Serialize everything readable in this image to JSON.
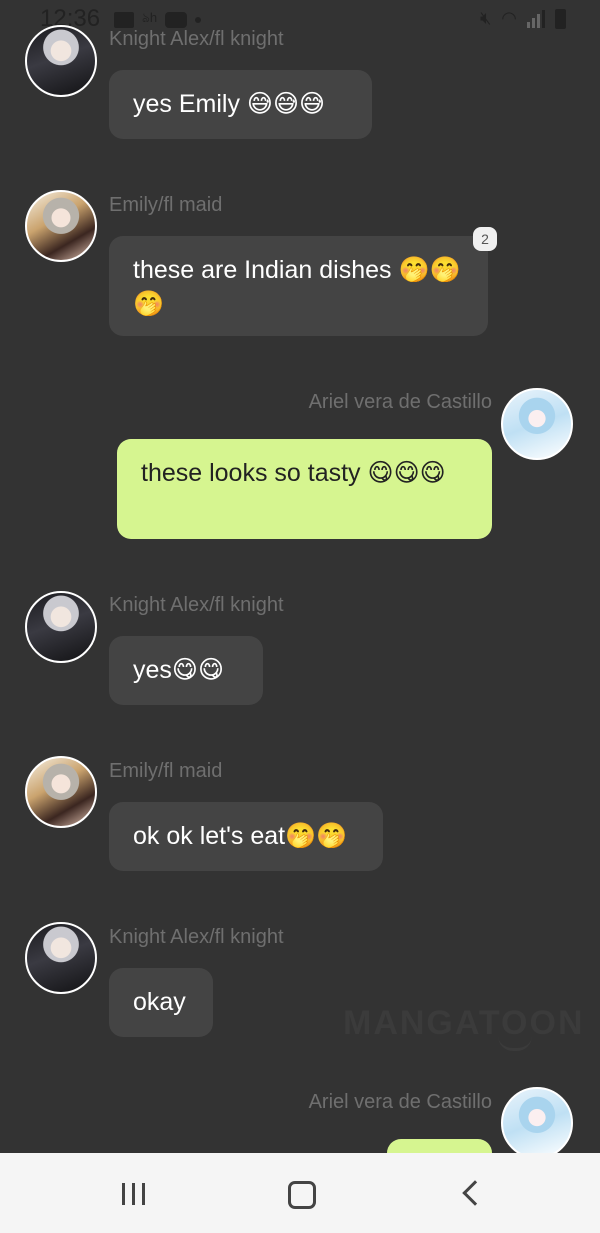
{
  "status_bar": {
    "time": "12:36",
    "left_icons": [
      "image-icon",
      "notification-icon",
      "youtube-icon",
      "dot-icon"
    ],
    "right_icons": [
      "mute-icon",
      "wifi-icon",
      "signal-icon",
      "battery-icon"
    ]
  },
  "messages": [
    {
      "sender": "Knight Alex/fl knight",
      "avatar": "knight-avatar",
      "text": "yes Emily 😅😅😅",
      "mine": false
    },
    {
      "sender": "Emily/fl maid",
      "avatar": "maid-avatar",
      "text": "these are Indian dishes 🤭🤭🤭",
      "mine": false,
      "reply_count": "2"
    },
    {
      "sender": "Ariel vera de Castillo",
      "avatar": "ariel-avatar",
      "text": "these looks so tasty 😋😋😋",
      "mine": true
    },
    {
      "sender": "Knight Alex/fl knight",
      "avatar": "knight-avatar",
      "text": "yes😋😋",
      "mine": false
    },
    {
      "sender": "Emily/fl maid",
      "avatar": "maid-avatar",
      "text": "ok ok let's eat🤭🤭",
      "mine": false
    },
    {
      "sender": "Knight Alex/fl knight",
      "avatar": "knight-avatar",
      "text": "okay",
      "mine": false
    },
    {
      "sender": "Ariel vera de Castillo",
      "avatar": "ariel-avatar",
      "text": "",
      "mine": true
    }
  ],
  "watermark": "MANGATOON",
  "nav_bar": {
    "buttons": [
      "recents-icon",
      "home-icon",
      "back-icon"
    ]
  },
  "colors": {
    "background": "#333333",
    "bubble_other": "#444444",
    "bubble_mine": "#d6f590",
    "sender_text": "#6f6f6f"
  }
}
